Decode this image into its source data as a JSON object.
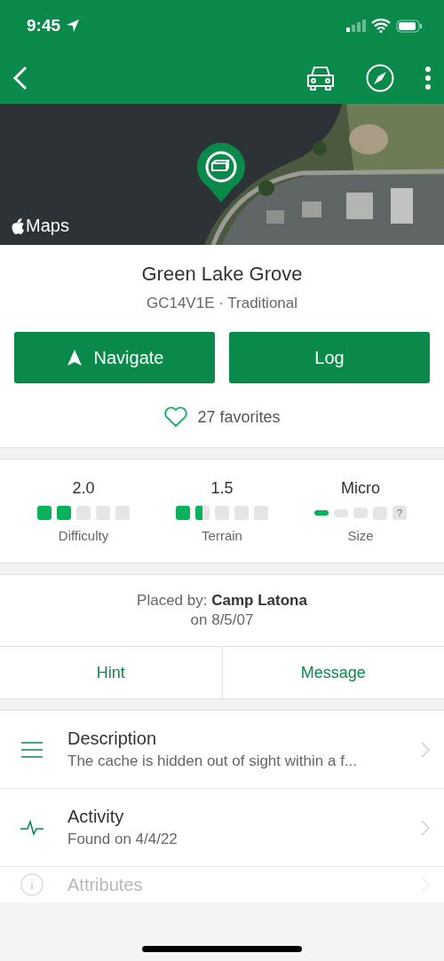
{
  "status_bar": {
    "time": "9:45"
  },
  "map": {
    "kind": "picture",
    "attribution": "Maps"
  },
  "cache": {
    "name": "Green Lake Grove",
    "code_type": "GC14V1E · Traditional",
    "favorites": "27 favorites"
  },
  "actions": [
    {
      "kind": "navigate",
      "label": "Navigate"
    },
    {
      "kind": "plain",
      "label": "Log"
    }
  ],
  "ratings": [
    {
      "kind": "pips",
      "value": "2.0",
      "label": "Difficulty",
      "stars": 2
    },
    {
      "kind": "pips",
      "value": "1.5",
      "label": "Terrain",
      "stars": 1.5
    },
    {
      "kind": "size",
      "value": "Micro",
      "label": "Size",
      "stars": 1,
      "unknown_mark": "?"
    }
  ],
  "placed": {
    "text": "Placed by: **Camp Latona**",
    "date": "on 8/5/07"
  },
  "tabs": [
    {
      "label": "Hint"
    },
    {
      "label": "Message"
    }
  ],
  "rows": [
    {
      "kind": "menu",
      "title": "Description",
      "subtitle": "The cache is hidden out of sight within a f..."
    },
    {
      "kind": "pulse",
      "title": "Activity",
      "subtitle": "Found on 4/4/22"
    },
    {
      "kind": "info",
      "title": "Attributes"
    }
  ]
}
